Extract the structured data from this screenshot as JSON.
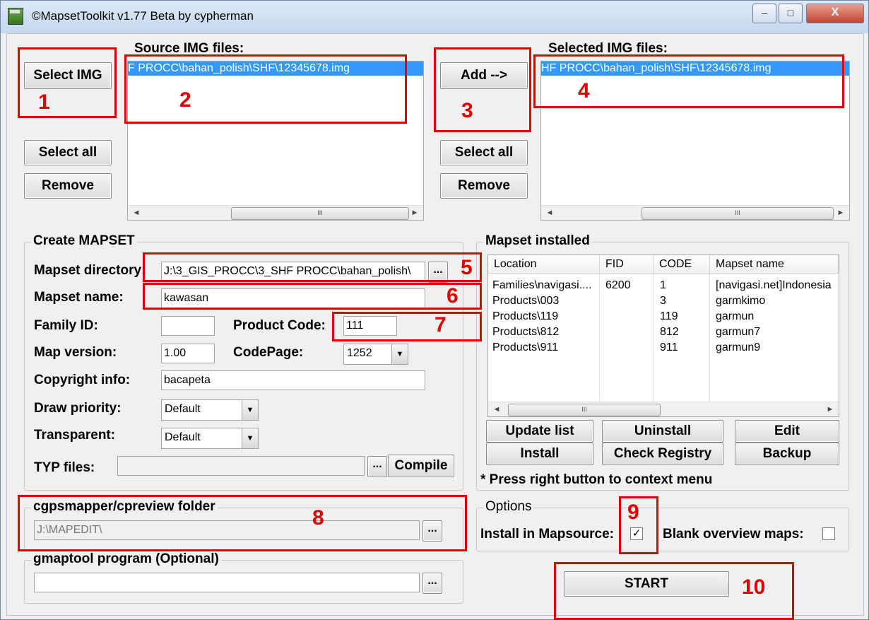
{
  "window": {
    "title": "©MapsetToolkit v1.77 Beta by cypherman",
    "minimize": "–",
    "maximize": "□",
    "close": "X"
  },
  "source": {
    "select_img": "Select IMG",
    "label": "Source IMG files:",
    "files": [
      "F PROCC\\bahan_polish\\SHF\\12345678.img"
    ],
    "select_all": "Select all",
    "remove": "Remove"
  },
  "selected": {
    "add": "Add -->",
    "label": "Selected IMG files:",
    "files": [
      "HF PROCC\\bahan_polish\\SHF\\12345678.img"
    ],
    "select_all": "Select all",
    "remove": "Remove"
  },
  "scroll": {
    "left": "◄",
    "right": "►",
    "thumb": "III"
  },
  "create": {
    "group": "Create MAPSET",
    "dir_label": "Mapset directory:",
    "dir_value": "J:\\3_GIS_PROCC\\3_SHF PROCC\\bahan_polish\\",
    "browse": "...",
    "name_label": "Mapset name:",
    "name_value": "kawasan",
    "family_label": "Family ID:",
    "family_value": "",
    "product_label": "Product Code:",
    "product_value": "111",
    "version_label": "Map version:",
    "version_value": "1.00",
    "codepage_label": "CodePage:",
    "codepage_value": "1252",
    "copyright_label": "Copyright info:",
    "copyright_value": "bacapeta",
    "draw_label": "Draw priority:",
    "draw_value": "Default",
    "transparent_label": "Transparent:",
    "transparent_value": "Default",
    "typ_label": "TYP files:",
    "typ_value": "",
    "compile": "Compile"
  },
  "installed": {
    "group": "Mapset installed",
    "columns": [
      "Location",
      "FID",
      "CODE",
      "Mapset name"
    ],
    "rows": [
      [
        "Families\\navigasi....",
        "6200",
        "1",
        "[navigasi.net]Indonesia"
      ],
      [
        "Products\\003",
        "",
        "3",
        "garmkimo"
      ],
      [
        "Products\\119",
        "",
        "119",
        "garmun"
      ],
      [
        "Products\\812",
        "",
        "812",
        "garmun7"
      ],
      [
        "Products\\911",
        "",
        "911",
        "garmun9"
      ]
    ],
    "update": "Update list",
    "uninstall": "Uninstall",
    "edit": "Edit",
    "install": "Install",
    "check": "Check Registry",
    "backup": "Backup",
    "note": "* Press right button to context menu"
  },
  "cgps": {
    "group": "cgpsmapper/cpreview folder",
    "value": "J:\\MAPEDIT\\"
  },
  "gmaptool": {
    "group": "gmaptool program (Optional)",
    "value": ""
  },
  "options": {
    "group": "Options",
    "install_ms": "Install in Mapsource:",
    "install_ms_checked": true,
    "blank": "Blank overview maps:",
    "blank_checked": false
  },
  "start": "START",
  "dropdown_arrow": "▼",
  "check_mark": "✓",
  "annotations": [
    "1",
    "2",
    "3",
    "4",
    "5",
    "6",
    "7",
    "8",
    "9",
    "10"
  ]
}
